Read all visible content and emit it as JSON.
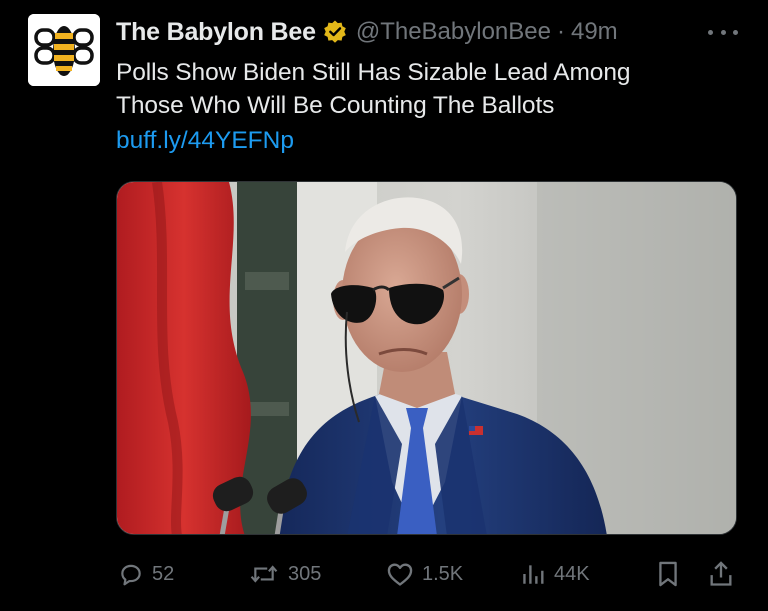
{
  "account": {
    "display_name": "The Babylon Bee",
    "handle": "@TheBabylonBee",
    "separator": "·",
    "timestamp": "49m",
    "verified_badge_color": "#e2b719"
  },
  "tweet": {
    "text_lines": [
      "Polls Show Biden Still Has Sizable Lead Among",
      "Those Who Will Be Counting The Ballots"
    ],
    "link": "buff.ly/44YEFNp"
  },
  "media": {
    "kind": "photo"
  },
  "actions": {
    "replies": "52",
    "reposts": "305",
    "likes": "1.5K",
    "views": "44K"
  },
  "colors": {
    "background": "#000000",
    "text_primary": "#e7e9ea",
    "text_secondary": "#71767b",
    "link": "#1d9bf0"
  },
  "icons": [
    "more-icon",
    "verified-badge-icon",
    "reply-icon",
    "repost-icon",
    "like-icon",
    "views-icon",
    "bookmark-icon",
    "share-icon"
  ]
}
